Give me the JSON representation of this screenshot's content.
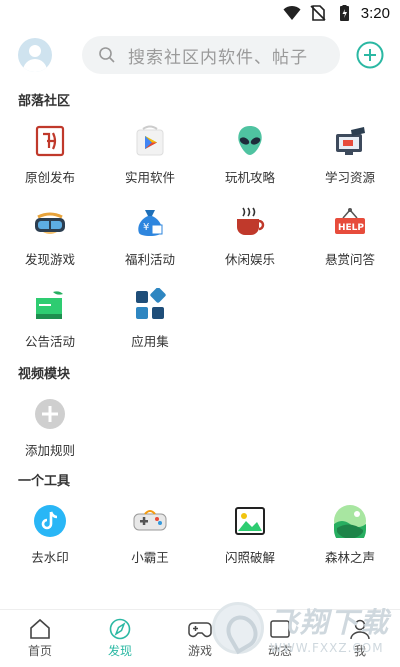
{
  "status_bar": {
    "time": "3:20",
    "icons": [
      "wifi-icon",
      "no-sim-icon",
      "battery-icon"
    ]
  },
  "header": {
    "search_placeholder": "搜索社区内软件、帖子",
    "add_icon": "plus-circle-icon"
  },
  "sections": {
    "tribe": {
      "title": "部落社区",
      "items": [
        {
          "label": "原创发布",
          "icon": "seal-icon"
        },
        {
          "label": "实用软件",
          "icon": "play-store-icon"
        },
        {
          "label": "玩机攻略",
          "icon": "alien-icon"
        },
        {
          "label": "学习资源",
          "icon": "graduation-screen-icon"
        },
        {
          "label": "发现游戏",
          "icon": "vr-headset-icon"
        },
        {
          "label": "福利活动",
          "icon": "money-bag-icon"
        },
        {
          "label": "休闲娱乐",
          "icon": "coffee-cup-icon"
        },
        {
          "label": "悬赏问答",
          "icon": "help-sign-icon"
        },
        {
          "label": "公告活动",
          "icon": "announcement-board-icon"
        },
        {
          "label": "应用集",
          "icon": "apps-collection-icon"
        }
      ]
    },
    "video": {
      "title": "视频模块",
      "items": [
        {
          "label": "添加规则",
          "icon": "add-rule-icon"
        }
      ]
    },
    "tools": {
      "title": "一个工具",
      "items": [
        {
          "label": "去水印",
          "icon": "tiktok-icon"
        },
        {
          "label": "小霸王",
          "icon": "gamepad-icon"
        },
        {
          "label": "闪照破解",
          "icon": "photo-icon"
        },
        {
          "label": "森林之声",
          "icon": "forest-icon"
        }
      ]
    }
  },
  "bottom_nav": [
    {
      "label": "首页",
      "icon": "home-icon"
    },
    {
      "label": "发现",
      "icon": "compass-icon",
      "active": true
    },
    {
      "label": "游戏",
      "icon": "gamepad-outline-icon"
    },
    {
      "label": "动态",
      "icon": "activity-icon"
    },
    {
      "label": "我",
      "icon": "profile-icon"
    }
  ],
  "watermark": {
    "main": "飞翔下载",
    "sub": "WWW.FXXZ.COM"
  },
  "colors": {
    "accent": "#2bb8a3",
    "search_bg": "#f1f3f4"
  }
}
